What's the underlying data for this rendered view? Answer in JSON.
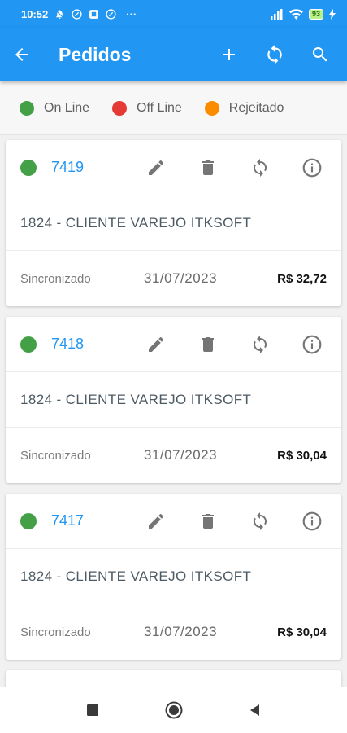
{
  "status_bar": {
    "time": "10:52",
    "more": "···",
    "battery": "93"
  },
  "header": {
    "title": "Pedidos",
    "back_icon": "arrow-left-icon",
    "add_icon": "plus-icon",
    "sync_icon": "sync-icon",
    "search_icon": "search-icon"
  },
  "legend": [
    {
      "label": "On Line",
      "color": "#43a047"
    },
    {
      "label": "Off Line",
      "color": "#e53935"
    },
    {
      "label": "Rejeitado",
      "color": "#fb8c00"
    }
  ],
  "orders": [
    {
      "number": "7419",
      "customer": "1824 - CLIENTE VAREJO ITKSOFT",
      "status": "Sincronizado",
      "date": "31/07/2023",
      "total": "R$ 32,72",
      "status_color": "#43a047"
    },
    {
      "number": "7418",
      "customer": "1824 - CLIENTE VAREJO ITKSOFT",
      "status": "Sincronizado",
      "date": "31/07/2023",
      "total": "R$ 30,04",
      "status_color": "#43a047"
    },
    {
      "number": "7417",
      "customer": "1824 - CLIENTE VAREJO ITKSOFT",
      "status": "Sincronizado",
      "date": "31/07/2023",
      "total": "R$ 30,04",
      "status_color": "#43a047"
    }
  ],
  "colors": {
    "primary": "#2196f3",
    "online": "#43a047",
    "offline": "#e53935",
    "rejected": "#fb8c00"
  }
}
